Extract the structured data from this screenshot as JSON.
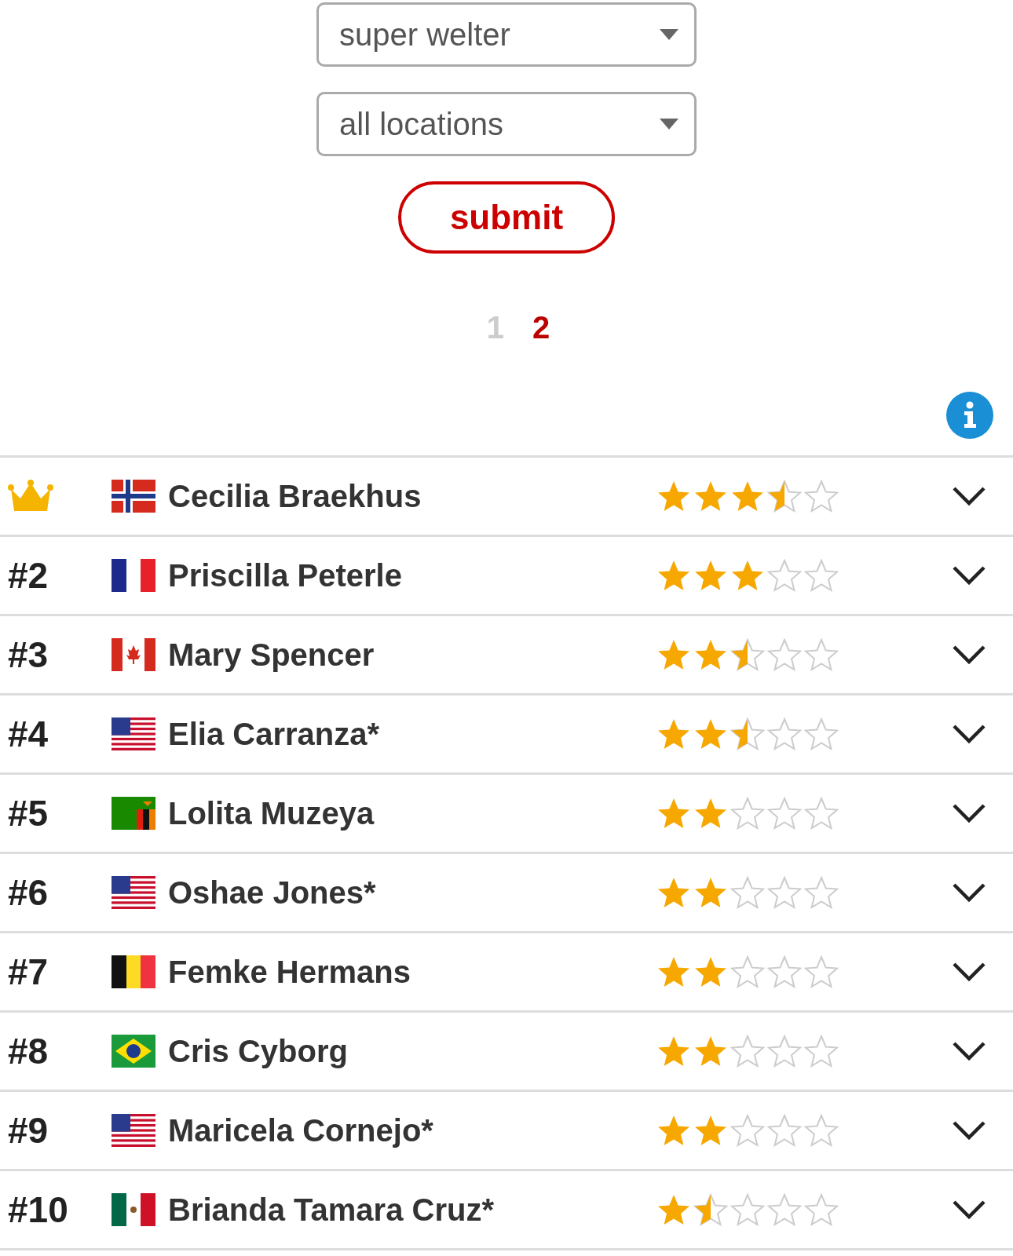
{
  "filters": [
    {
      "value": "super welter"
    },
    {
      "value": "all locations"
    }
  ],
  "submit_button": {
    "label": "submit"
  },
  "pagination": [
    {
      "label": "1",
      "selected": false
    },
    {
      "label": "2",
      "selected": true
    }
  ],
  "rankings": [
    {
      "kind": "crown",
      "name": "Cecilia Braekhus",
      "stars": 3.5
    },
    {
      "kind": "rank",
      "rank": "#2",
      "name": "Priscilla Peterle",
      "stars": 3
    },
    {
      "kind": "rank",
      "rank": "#3",
      "name": "Mary Spencer",
      "stars": 2.5
    },
    {
      "kind": "rank",
      "rank": "#4",
      "name": "Elia Carranza*",
      "stars": 2.5
    },
    {
      "kind": "rank",
      "rank": "#5",
      "name": "Lolita Muzeya",
      "stars": 2
    },
    {
      "kind": "rank",
      "rank": "#6",
      "name": "Oshae Jones*",
      "stars": 2
    },
    {
      "kind": "rank",
      "rank": "#7",
      "name": "Femke Hermans",
      "stars": 2
    },
    {
      "kind": "rank",
      "rank": "#8",
      "name": "Cris Cyborg",
      "stars": 2
    },
    {
      "kind": "rank",
      "rank": "#9",
      "name": "Maricela Cornejo*",
      "stars": 2
    },
    {
      "kind": "rank",
      "rank": "#10",
      "name": "Brianda Tamara Cruz*",
      "stars": 1.5
    }
  ]
}
